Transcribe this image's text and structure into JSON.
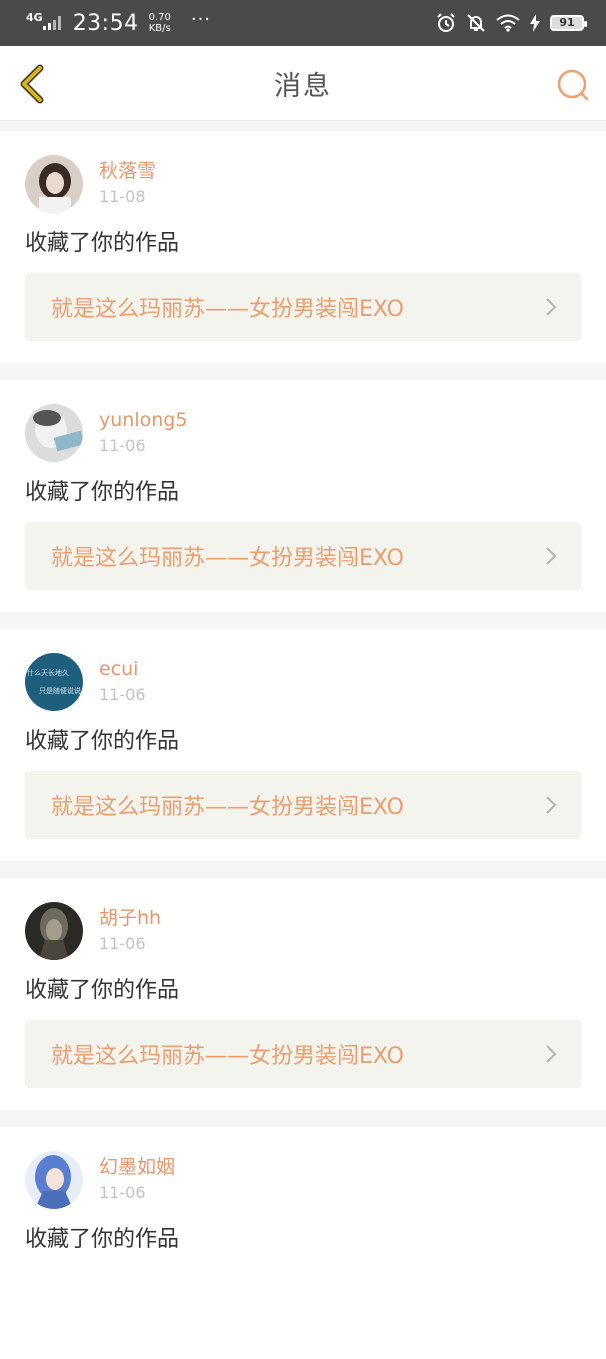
{
  "status_bar": {
    "network": "4G",
    "time": "23:54",
    "speed_value": "0.70",
    "speed_unit": "KB/s",
    "more": "···",
    "battery": "91"
  },
  "nav": {
    "title": "消息"
  },
  "messages": [
    {
      "username": "秋落雪",
      "date": "11-08",
      "action": "收藏了你的作品",
      "work_title": "就是这么玛丽苏——女扮男装闯EXO"
    },
    {
      "username": "yunlong5",
      "date": "11-06",
      "action": "收藏了你的作品",
      "work_title": "就是这么玛丽苏——女扮男装闯EXO"
    },
    {
      "username": "ecui",
      "date": "11-06",
      "action": "收藏了你的作品",
      "work_title": "就是这么玛丽苏——女扮男装闯EXO",
      "avatar_text_1": "什么天长地久",
      "avatar_text_2": "只是随便说说"
    },
    {
      "username": "胡子hh",
      "date": "11-06",
      "action": "收藏了你的作品",
      "work_title": "就是这么玛丽苏——女扮男装闯EXO"
    },
    {
      "username": "幻墨如姻",
      "date": "11-06",
      "action": "收藏了你的作品"
    }
  ],
  "colors": {
    "accent": "#e8976a",
    "link_bg": "#f4f4ee",
    "status_bar_bg": "#4a4a4a",
    "back_icon": "#d6b320"
  }
}
